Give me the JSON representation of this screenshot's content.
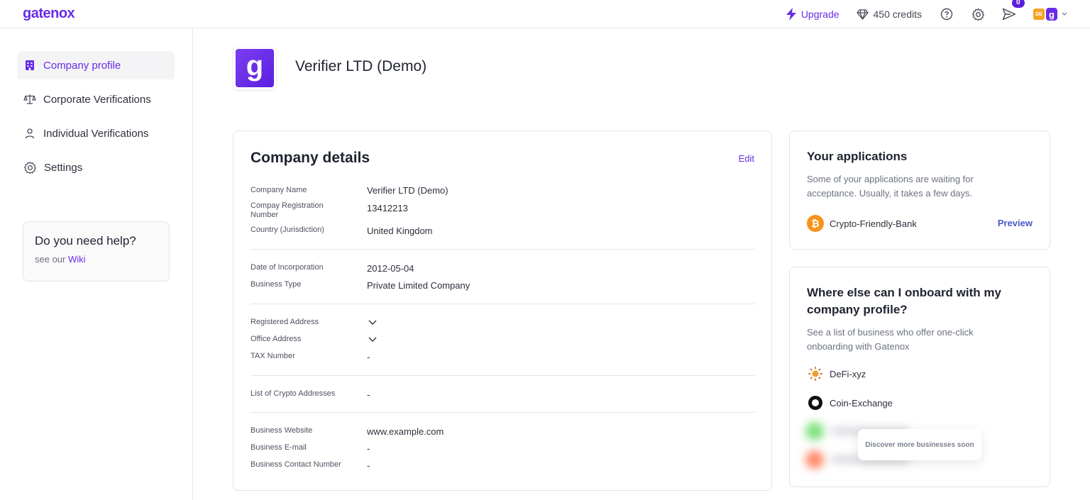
{
  "header": {
    "logo": "gatenox",
    "upgrade_label": "Upgrade",
    "credits_label": "450 credits",
    "notifications_count": "0",
    "avatar_initials": "DE",
    "avatar_letter": "g"
  },
  "sidebar": {
    "items": [
      {
        "label": "Company profile",
        "icon": "building-icon"
      },
      {
        "label": "Corporate Verifications",
        "icon": "scales-icon"
      },
      {
        "label": "Individual Verifications",
        "icon": "user-icon"
      },
      {
        "label": "Settings",
        "icon": "gear-icon"
      }
    ],
    "help": {
      "title": "Do you need help?",
      "prefix": "see our ",
      "link": "Wiki"
    }
  },
  "company": {
    "logo_letter": "g",
    "name": "Verifier LTD (Demo)"
  },
  "details": {
    "heading": "Company details",
    "edit_label": "Edit",
    "fields": {
      "company_name": {
        "label": "Company Name",
        "value": "Verifier LTD (Demo)"
      },
      "registration_number": {
        "label": "Compay Registration Number",
        "value": "13412213"
      },
      "country": {
        "label": "Country (Jurisdiction)",
        "value": "United Kingdom"
      },
      "date_of_incorporation": {
        "label": "Date of Incorporation",
        "value": "2012-05-04"
      },
      "business_type": {
        "label": "Business Type",
        "value": "Private Limited Company"
      },
      "registered_address": {
        "label": "Registered Address"
      },
      "office_address": {
        "label": "Office Address"
      },
      "tax_number": {
        "label": "TAX Number",
        "value": "-"
      },
      "crypto_addresses": {
        "label": "List of Crypto Addresses",
        "value": "-"
      },
      "website": {
        "label": "Business Website",
        "value": "www.example.com"
      },
      "email": {
        "label": "Business E-mail",
        "value": "-"
      },
      "contact_number": {
        "label": "Business Contact Number",
        "value": "-"
      }
    }
  },
  "applications": {
    "title": "Your applications",
    "description": "Some of your applications are waiting for acceptance. Usually, it takes a few days.",
    "items": [
      {
        "name": "Crypto-Friendly-Bank",
        "action": "Preview",
        "icon": "bitcoin-icon"
      }
    ]
  },
  "onboard": {
    "title": "Where else can I onboard with my company profile?",
    "description": "See a list of business who offer one-click onboarding with Gatenox",
    "items": [
      {
        "name": "DeFi-xyz",
        "icon": "sun-icon"
      },
      {
        "name": "Coin-Exchange",
        "icon": "ring-icon"
      }
    ],
    "soon_label": "Discover more businesses soon"
  },
  "colors": {
    "accent": "#6a2be8",
    "preview": "#4a56c8",
    "bitcoin": "#f7931a"
  }
}
